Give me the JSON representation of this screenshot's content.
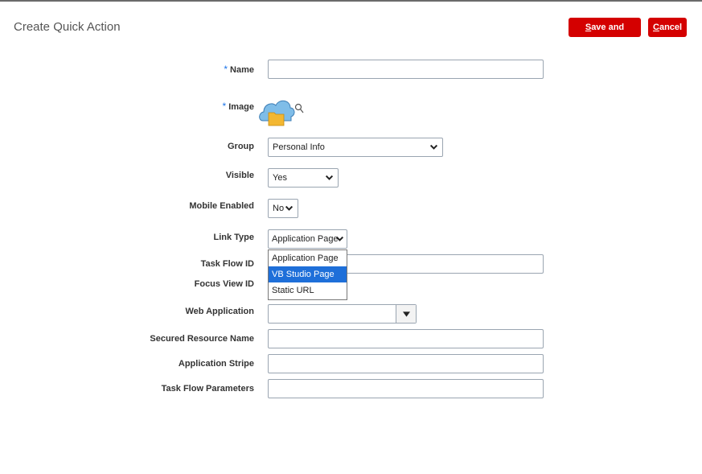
{
  "page": {
    "title": "Create Quick Action",
    "save_and_close": {
      "accel": "S",
      "rest": "ave and Close"
    },
    "cancel": {
      "accel": "C",
      "rest": "ancel"
    }
  },
  "form": {
    "required_marker": "*",
    "name": {
      "label": "Name",
      "value": ""
    },
    "image": {
      "label": "Image"
    },
    "group": {
      "label": "Group",
      "value": "Personal Info"
    },
    "visible": {
      "label": "Visible",
      "value": "Yes"
    },
    "mobile_enabled": {
      "label": "Mobile Enabled",
      "value": "No"
    },
    "link_type": {
      "label": "Link Type",
      "value": "Application Page",
      "options": [
        "Application Page",
        "VB Studio Page",
        "Static URL"
      ],
      "highlighted": "VB Studio Page"
    },
    "task_flow_id": {
      "label": "Task Flow ID",
      "value": ""
    },
    "focus_view_id": {
      "label": "Focus View ID"
    },
    "web_application": {
      "label": "Web Application",
      "value": ""
    },
    "secured_resource_name": {
      "label": "Secured Resource Name",
      "value": ""
    },
    "application_stripe": {
      "label": "Application Stripe",
      "value": ""
    },
    "task_flow_parameters": {
      "label": "Task Flow Parameters",
      "value": ""
    }
  },
  "colors": {
    "accent": "#d40000",
    "highlight": "#1e6fd9",
    "required": "#1a73e8"
  },
  "icons": {
    "image": "cloud-folder-icon",
    "search": "search-icon",
    "dropdown": "chevron-down-icon"
  }
}
